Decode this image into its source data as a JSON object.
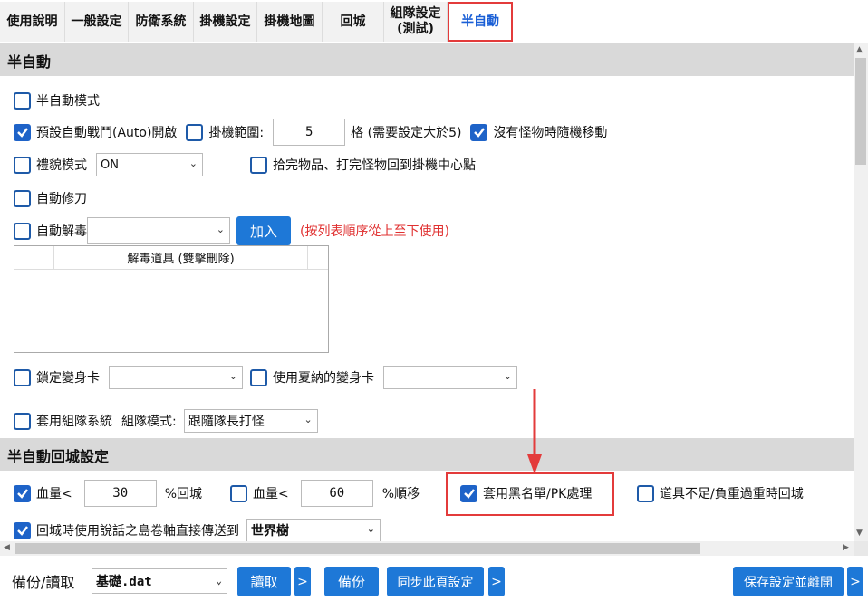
{
  "tabs": [
    {
      "label": "使用說明"
    },
    {
      "label": "一般設定"
    },
    {
      "label": "防衛系統"
    },
    {
      "label": "掛機設定"
    },
    {
      "label": "掛機地圖"
    },
    {
      "label": "回城"
    },
    {
      "label": "組隊設定\n(測試)"
    },
    {
      "label": "半自動"
    }
  ],
  "section1": {
    "title": "半自動"
  },
  "semi_auto_mode": {
    "label": "半自動模式",
    "checked": false
  },
  "auto_battle": {
    "label": "預設自動戰鬥(Auto)開啟",
    "checked": true
  },
  "range": {
    "label": "掛機範圍:",
    "value": "5",
    "suffix": "格 (需要設定大於5)",
    "checked": false
  },
  "random_move": {
    "label": "沒有怪物時隨機移動",
    "checked": true
  },
  "courtesy": {
    "label": "禮貌模式",
    "value": "ON",
    "checked": false
  },
  "return_center": {
    "label": "拾完物品、打完怪物回到掛機中心點",
    "checked": false
  },
  "auto_repair": {
    "label": "自動修刀",
    "checked": false
  },
  "auto_detox": {
    "label": "自動解毒",
    "value": "",
    "add_button": "加入",
    "hint": "(按列表順序從上至下使用)",
    "checked": false
  },
  "detox_list": {
    "header": "解毒道具 (雙擊刪除)"
  },
  "lock_poly": {
    "label": "鎖定變身卡",
    "value": "",
    "checked": false
  },
  "xiana_poly": {
    "label": "使用夏納的變身卡",
    "value": "",
    "checked": false
  },
  "party": {
    "label": "套用組隊系統",
    "mode_label": "組隊模式:",
    "mode_value": "跟隨隊長打怪",
    "checked": false
  },
  "section2": {
    "title": "半自動回城設定"
  },
  "hp_return": {
    "label": "血量<",
    "value": "30",
    "suffix": "%回城",
    "checked": true
  },
  "hp_move": {
    "label": "血量<",
    "value": "60",
    "suffix": "%順移",
    "checked": false
  },
  "blacklist": {
    "label": "套用黑名單/PK處理",
    "checked": true
  },
  "item_short": {
    "label": "道具不足/負重過重時回城",
    "checked": false
  },
  "scroll_send": {
    "label": "回城時使用說話之島卷軸直接傳送到",
    "value": "世界樹",
    "checked": true
  },
  "bottom": {
    "backup_label": "備份/讀取",
    "file_value": "基礎.dat",
    "read_button": "讀取",
    "more1": ">",
    "backup_button": "備份",
    "sync_button": "同步此頁設定",
    "more2": ">",
    "save_exit_button": "保存設定並離開",
    "more3": ">"
  },
  "colors": {
    "accent": "#1e78d7",
    "highlight": "#e33b3b",
    "section_bg": "#d9d9d9",
    "hint": "#e03030"
  }
}
